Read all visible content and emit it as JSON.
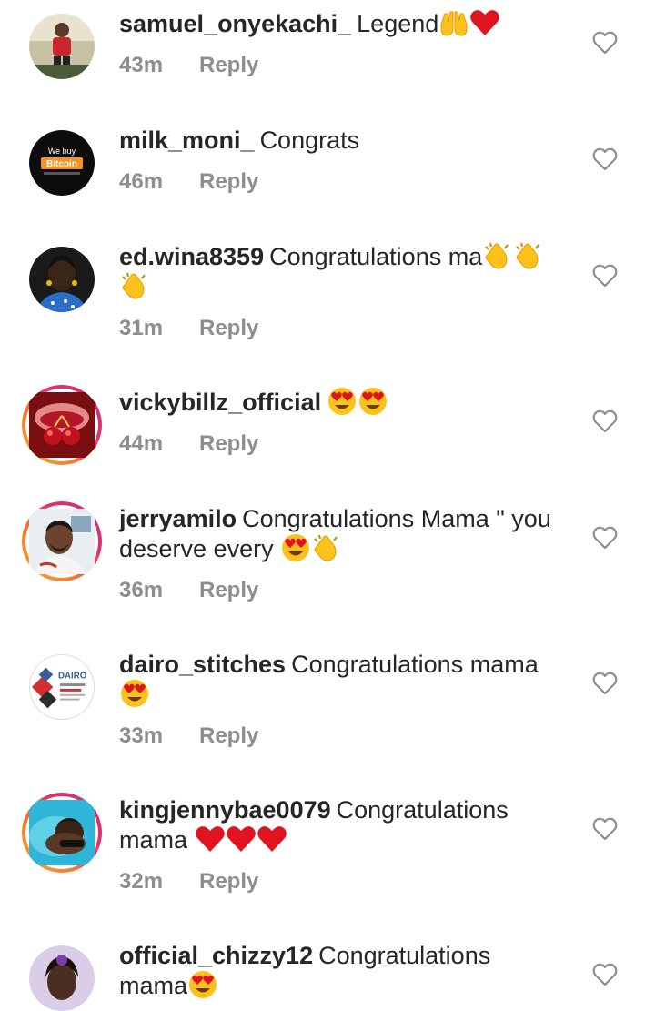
{
  "comments": [
    {
      "username": "samuel_onyekachi_",
      "text": "Legend",
      "emojis": [
        "raised-hands",
        "red-heart"
      ],
      "time": "43m",
      "reply": "Reply"
    },
    {
      "username": "milk_moni_",
      "text": "Congrats",
      "emojis": [],
      "time": "46m",
      "reply": "Reply"
    },
    {
      "username": "ed.wina8359",
      "text": "Congratulations ma",
      "emojis": [
        "clapping",
        "clapping",
        "clapping"
      ],
      "time": "31m",
      "reply": "Reply"
    },
    {
      "username": "vickybillz_official",
      "text": "",
      "emojis": [
        "heart-eyes",
        "heart-eyes"
      ],
      "time": "44m",
      "reply": "Reply"
    },
    {
      "username": "jerryamilo",
      "text": "Congratulations Mama \" you deserve every",
      "emojis": [
        "heart-eyes",
        "clapping"
      ],
      "time": "36m",
      "reply": "Reply"
    },
    {
      "username": "dairo_stitches",
      "text": "Congratulations mama",
      "emojis": [
        "heart-eyes"
      ],
      "time": "33m",
      "reply": "Reply"
    },
    {
      "username": "kingjennybae0079",
      "text": "Congratulations mama",
      "emojis": [
        "red-heart",
        "red-heart",
        "red-heart"
      ],
      "time": "32m",
      "reply": "Reply"
    },
    {
      "username": "official_chizzy12",
      "text": "Congratulations mama",
      "emojis": [
        "heart-eyes"
      ],
      "time": "",
      "reply": ""
    }
  ],
  "avatars": {
    "milk_moni": {
      "line1": "We buy",
      "line2": "Bitcoin"
    },
    "dairo": {
      "brand": "DAIRO"
    }
  },
  "colors": {
    "username": "#262626",
    "meta": "#8e8e8e",
    "story_ring_start": "#f9b233",
    "story_ring_end": "#c13584",
    "heart_outline": "#8e8e8e"
  }
}
